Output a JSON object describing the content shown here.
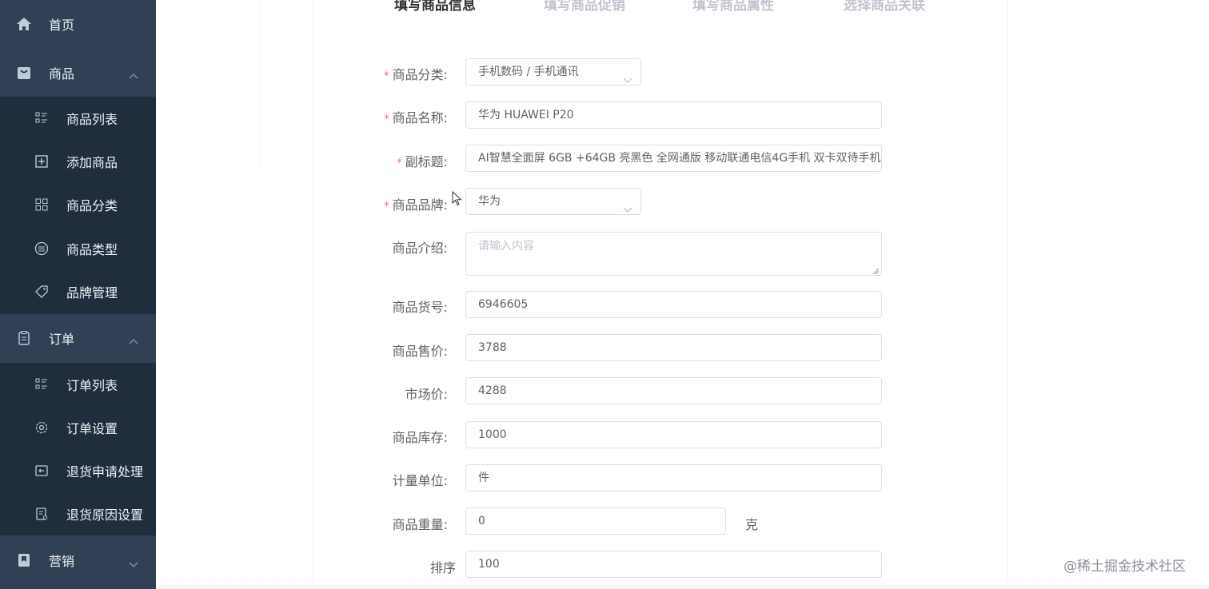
{
  "sidebar": {
    "home": "首页",
    "goods": "商品",
    "goods_items": [
      "商品列表",
      "添加商品",
      "商品分类",
      "商品类型",
      "品牌管理"
    ],
    "order": "订单",
    "order_items": [
      "订单列表",
      "订单设置",
      "退货申请处理",
      "退货原因设置"
    ],
    "marketing": "营销"
  },
  "steps": [
    "填写商品信息",
    "填写商品促销",
    "填写商品属性",
    "选择商品关联"
  ],
  "form": {
    "category": {
      "label": "商品分类:",
      "value": "手机数码 / 手机通讯"
    },
    "name": {
      "label": "商品名称:",
      "value": "华为 HUAWEI P20"
    },
    "subtitle": {
      "label": "副标题:",
      "value": "AI智慧全面屏 6GB +64GB 亮黑色 全网通版 移动联通电信4G手机 双卡双待手机"
    },
    "brand": {
      "label": "商品品牌:",
      "value": "华为"
    },
    "intro": {
      "label": "商品介绍:",
      "placeholder": "请输入内容"
    },
    "sn": {
      "label": "商品货号:",
      "value": "6946605"
    },
    "price": {
      "label": "商品售价:",
      "value": "3788"
    },
    "market_price": {
      "label": "市场价:",
      "value": "4288"
    },
    "stock": {
      "label": "商品库存:",
      "value": "1000"
    },
    "unit": {
      "label": "计量单位:",
      "value": "件"
    },
    "weight": {
      "label": "商品重量:",
      "value": "0",
      "unit": "克"
    },
    "sort": {
      "label": "排序",
      "value": "100"
    }
  },
  "watermark": "@稀土掘金技术社区",
  "colors": {
    "sidebar_bg": "#304156",
    "submenu_bg": "#1f2d3d",
    "required": "#f56c6c"
  }
}
